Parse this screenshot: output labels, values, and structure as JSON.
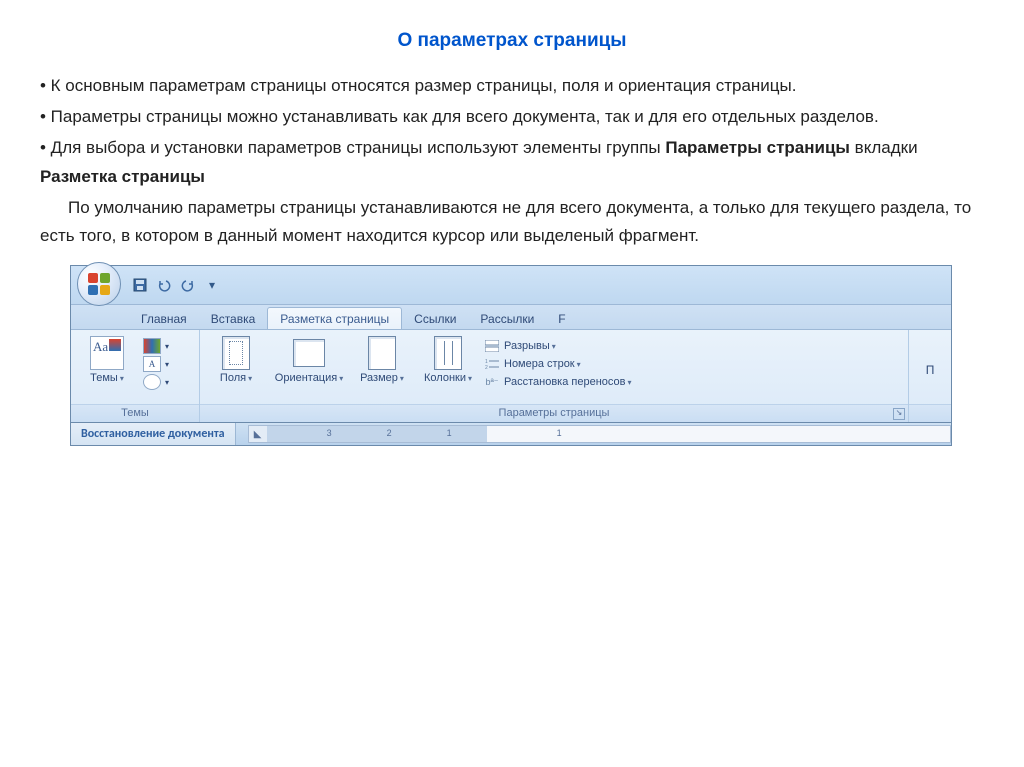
{
  "title": "О параметрах страницы",
  "paragraphs": {
    "p1": "•    К основным параметрам страницы относятся размер страницы, поля и ориентация страницы.",
    "p2": "•    Параметры страницы можно устанавливать как для всего документа, так и для его отдельных разделов.",
    "p3a": "•    Для выбора и установки параметров страницы используют элементы группы ",
    "p3b": "Параметры страницы",
    "p3c": " вкладки ",
    "p3d": "Разметка страницы",
    "p4": "По умолчанию параметры страницы устанавливаются не для всего документа, а только для текущего раздела, то есть того, в котором в данный момент находится курсор или выделеный фрагмент."
  },
  "ribbon": {
    "tabs": {
      "home": "Главная",
      "insert": "Вставка",
      "layout": "Разметка страницы",
      "references": "Ссылки",
      "mailings": "Рассылки"
    },
    "groups": {
      "themes": {
        "label": "Темы",
        "themes_btn": "Темы"
      },
      "pagesetup": {
        "label": "Параметры страницы",
        "margins": "Поля",
        "orientation": "Ориентация",
        "size": "Размер",
        "columns": "Колонки",
        "breaks": "Разрывы",
        "line_numbers": "Номера строк",
        "hyphenation": "Расстановка переносов"
      },
      "right_cut": "П"
    },
    "status": {
      "recovery": "Восстановление документа",
      "ruler_numbers": [
        "3",
        "2",
        "1",
        "1"
      ]
    }
  }
}
